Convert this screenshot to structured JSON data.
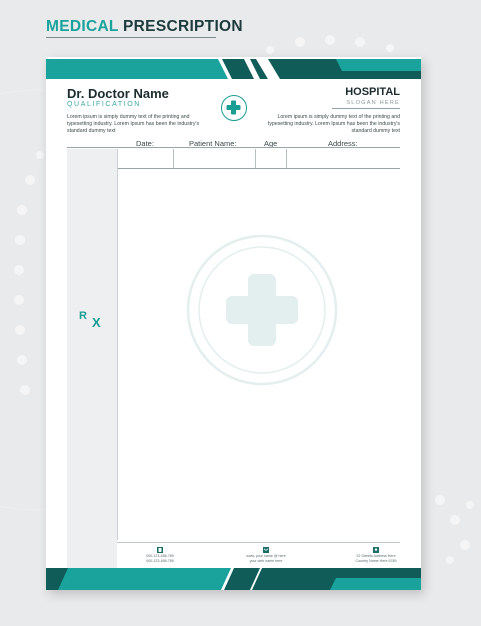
{
  "banner": {
    "word1": "MEDICAL",
    "word2": " PRESCRIPTION"
  },
  "header": {
    "doctor_name": "Dr. Doctor Name",
    "qualification": "QUALIFICATION",
    "left_text": "Lorem ipsum is simply dummy text of the printing and typesetting industry. Lorem Ipsum has been the industry's standard dummy text",
    "hospital_name": "HOSPITAL",
    "slogan": "SLOGAN HERE",
    "right_text": "Lorem ipsum is simply dummy text of the printing and typesetting industry. Lorem Ipsum has been the industry's standard dummy text"
  },
  "form": {
    "date_label": "Date:",
    "patient_label": "Patient Name:",
    "age_label": "Age",
    "address_label": "Address:"
  },
  "rx": {
    "r": "R",
    "x": "X"
  },
  "footer": {
    "phone_line1": "000-123-456-789",
    "phone_line2": "000-123-456-789",
    "email_line1": "www. your name @ here",
    "email_line2": "your web name here",
    "address_line1": "22 Streets Address Here",
    "address_line2": "Country Name Here 6789"
  },
  "colors": {
    "teal": "#1aa39c",
    "dark_teal": "#0f5c58",
    "text_dark": "#1c2b2d"
  },
  "icons": [
    "medical-cross-icon",
    "phone-icon",
    "email-icon",
    "location-icon"
  ]
}
